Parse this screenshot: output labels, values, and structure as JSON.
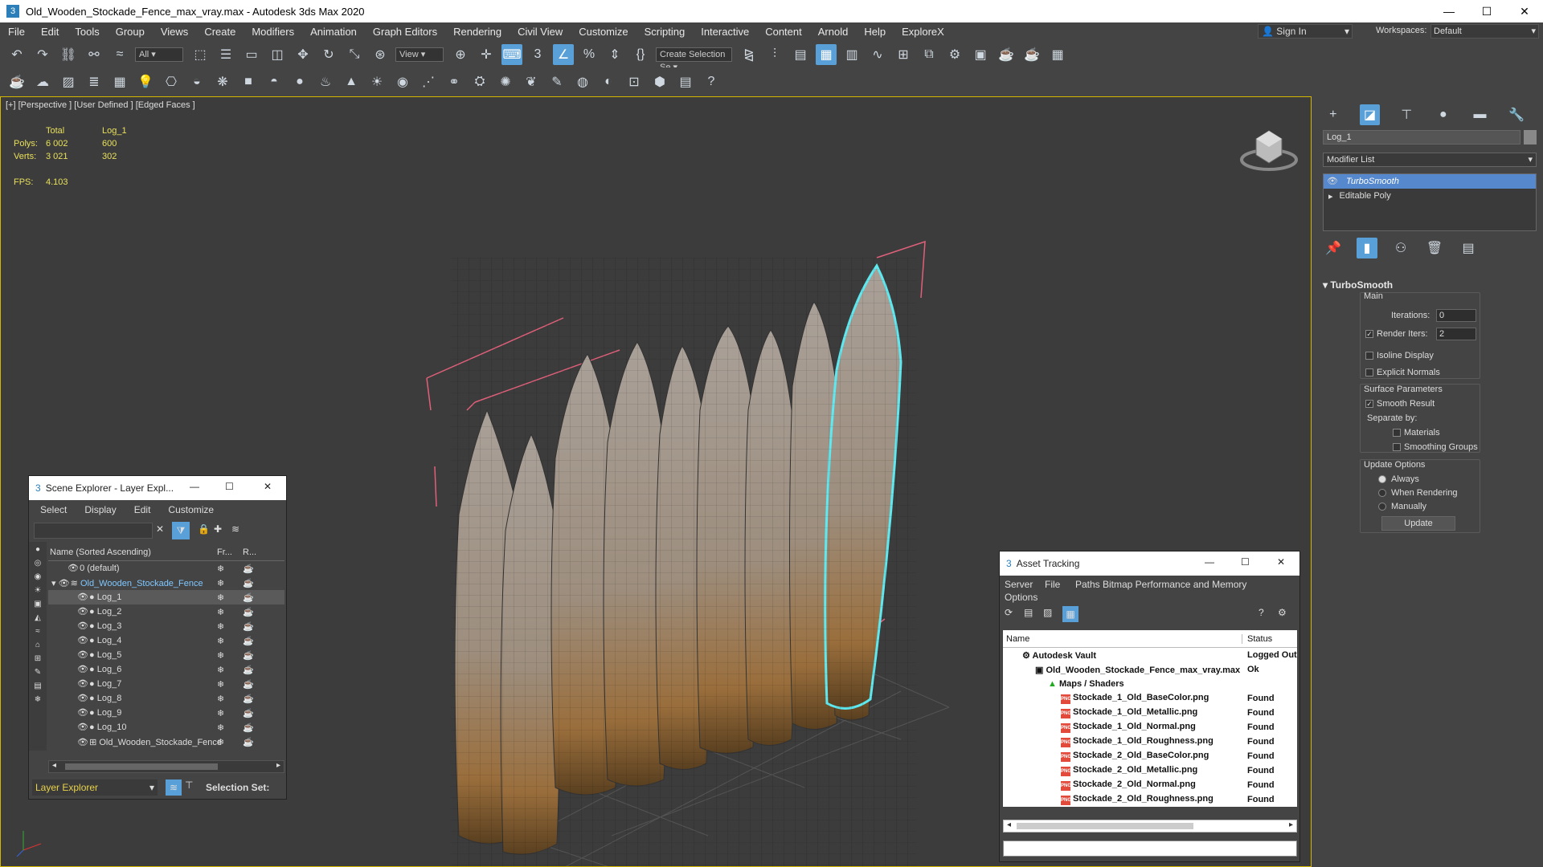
{
  "window": {
    "title": "Old_Wooden_Stockade_Fence_max_vray.max - Autodesk 3ds Max 2020",
    "app_icon": "3",
    "minimize": "—",
    "maximize": "☐",
    "close": "✕"
  },
  "menu": [
    "File",
    "Edit",
    "Tools",
    "Group",
    "Views",
    "Create",
    "Modifiers",
    "Animation",
    "Graph Editors",
    "Rendering",
    "Civil View",
    "Customize",
    "Scripting",
    "Interactive",
    "Content",
    "Arnold",
    "Help",
    "ExploreX"
  ],
  "signin": "Sign In",
  "workspaces_label": "Workspaces:",
  "workspace_value": "Default",
  "toolbar1": {
    "filter": "All",
    "view": "View",
    "selection_set": "Create Selection Se"
  },
  "viewport": {
    "label": "[+] [Perspective ] [User Defined ] [Edged Faces ]",
    "stats": {
      "h_total": "Total",
      "h_obj": "Log_1",
      "polys_label": "Polys:",
      "polys_total": "6 002",
      "polys_obj": "600",
      "verts_label": "Verts:",
      "verts_total": "3 021",
      "verts_obj": "302",
      "fps_label": "FPS:",
      "fps_value": "4.103"
    }
  },
  "command_panel": {
    "object_name": "Log_1",
    "modifier_list": "Modifier List",
    "stack": [
      "TurboSmooth",
      "Editable Poly"
    ],
    "turbosmooth": {
      "title": "TurboSmooth",
      "main": "Main",
      "iterations_label": "Iterations:",
      "iterations": "0",
      "render_iters_label": "Render Iters:",
      "render_iters": "2",
      "isoline": "Isoline Display",
      "explicit": "Explicit Normals",
      "surface_params": "Surface Parameters",
      "smooth_result": "Smooth Result",
      "separate_by": "Separate by:",
      "materials": "Materials",
      "smoothing_groups": "Smoothing Groups",
      "update_options": "Update Options",
      "always": "Always",
      "when_rendering": "When Rendering",
      "manually": "Manually",
      "update": "Update"
    }
  },
  "scene_explorer": {
    "title": "Scene Explorer - Layer Expl...",
    "menu": [
      "Select",
      "Display",
      "Edit",
      "Customize"
    ],
    "col_name": "Name (Sorted Ascending)",
    "col_fr": "Fr...",
    "col_r": "R...",
    "rows": [
      "0 (default)",
      "Old_Wooden_Stockade_Fence",
      "Log_1",
      "Log_2",
      "Log_3",
      "Log_4",
      "Log_5",
      "Log_6",
      "Log_7",
      "Log_8",
      "Log_9",
      "Log_10",
      "Old_Wooden_Stockade_Fence"
    ],
    "footer_select": "Layer Explorer",
    "selection_set": "Selection Set:"
  },
  "asset_tracking": {
    "title": "Asset Tracking",
    "menu": [
      "Server",
      "File",
      "Paths",
      "Bitmap Performance and Memory",
      "Options"
    ],
    "col_name": "Name",
    "col_status": "Status",
    "rows": [
      {
        "name": "Autodesk Vault",
        "status": "Logged Out"
      },
      {
        "name": "Old_Wooden_Stockade_Fence_max_vray.max",
        "status": "Ok"
      },
      {
        "name": "Maps / Shaders",
        "status": ""
      },
      {
        "name": "Stockade_1_Old_BaseColor.png",
        "status": "Found"
      },
      {
        "name": "Stockade_1_Old_Metallic.png",
        "status": "Found"
      },
      {
        "name": "Stockade_1_Old_Normal.png",
        "status": "Found"
      },
      {
        "name": "Stockade_1_Old_Roughness.png",
        "status": "Found"
      },
      {
        "name": "Stockade_2_Old_BaseColor.png",
        "status": "Found"
      },
      {
        "name": "Stockade_2_Old_Metallic.png",
        "status": "Found"
      },
      {
        "name": "Stockade_2_Old_Normal.png",
        "status": "Found"
      },
      {
        "name": "Stockade_2_Old_Roughness.png",
        "status": "Found"
      }
    ]
  }
}
